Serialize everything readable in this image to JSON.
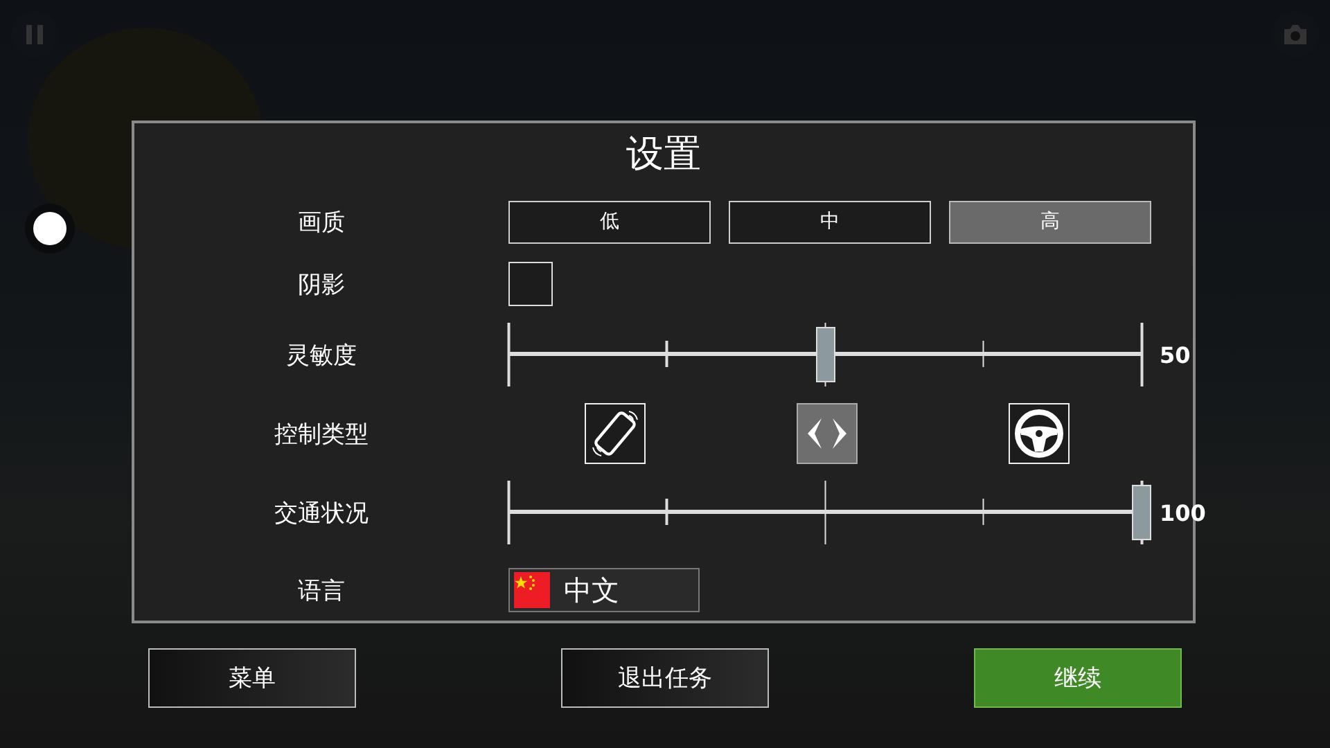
{
  "dialog": {
    "title": "设置",
    "quality": {
      "label": "画质",
      "options": [
        {
          "label": "低",
          "selected": false
        },
        {
          "label": "中",
          "selected": false
        },
        {
          "label": "高",
          "selected": true
        }
      ]
    },
    "shadow": {
      "label": "阴影",
      "checked": false
    },
    "sensitivity": {
      "label": "灵敏度",
      "level": 0.5,
      "reading": "50"
    },
    "control_type": {
      "label": "控制类型",
      "options": [
        {
          "kind": "tilt",
          "selected": false
        },
        {
          "kind": "arrows",
          "selected": true
        },
        {
          "kind": "wheel",
          "selected": false
        }
      ]
    },
    "traffic": {
      "label": "交通状况",
      "level": 1.0,
      "reading": "100"
    },
    "language": {
      "label": "语言",
      "value": "中文"
    }
  },
  "buttons": [
    {
      "label": "菜单",
      "kind": "normal"
    },
    {
      "label": "退出任务",
      "kind": "normal"
    },
    {
      "label": "继续",
      "kind": "primary"
    }
  ]
}
